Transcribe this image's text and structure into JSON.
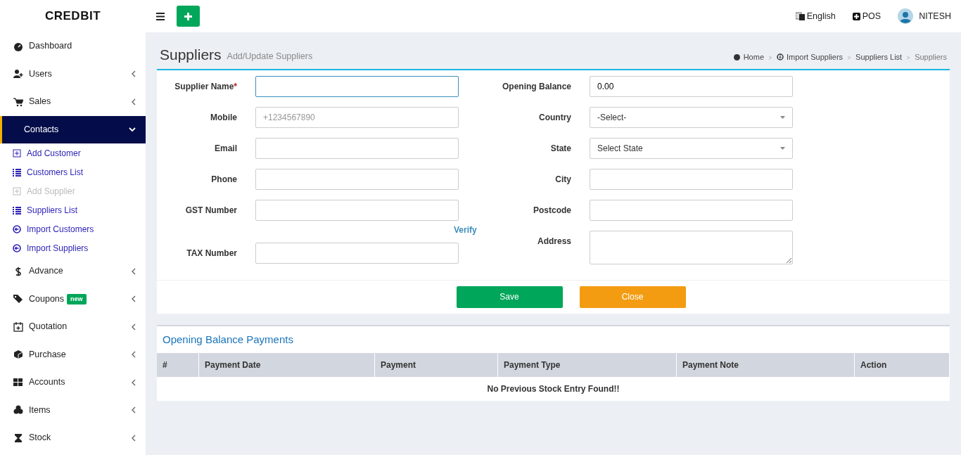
{
  "brand": "CREDBIT",
  "topbar": {
    "language": "English",
    "pos": "POS",
    "user": "NITESH"
  },
  "sidebar": {
    "items": [
      {
        "label": "Dashboard",
        "has_arrow": false,
        "expanded": false
      },
      {
        "label": "Users",
        "has_arrow": true,
        "expanded": false
      },
      {
        "label": "Sales",
        "has_arrow": true,
        "expanded": false
      },
      {
        "label": "Contacts",
        "has_arrow": true,
        "expanded": true,
        "children": [
          {
            "label": "Add Customer",
            "selected": false
          },
          {
            "label": "Customers List",
            "selected": false
          },
          {
            "label": "Add Supplier",
            "selected": true
          },
          {
            "label": "Suppliers List",
            "selected": false
          },
          {
            "label": "Import Customers",
            "selected": false
          },
          {
            "label": "Import Suppliers",
            "selected": false
          }
        ]
      },
      {
        "label": "Advance",
        "has_arrow": true,
        "expanded": false
      },
      {
        "label": "Coupons",
        "badge": "new",
        "has_arrow": true,
        "expanded": false
      },
      {
        "label": "Quotation",
        "has_arrow": true,
        "expanded": false
      },
      {
        "label": "Purchase",
        "has_arrow": true,
        "expanded": false
      },
      {
        "label": "Accounts",
        "has_arrow": true,
        "expanded": false
      },
      {
        "label": "Items",
        "has_arrow": true,
        "expanded": false
      },
      {
        "label": "Stock",
        "has_arrow": true,
        "expanded": false
      }
    ]
  },
  "page": {
    "title": "Suppliers",
    "subtitle": "Add/Update Suppliers"
  },
  "breadcrumb": [
    "Home",
    "Import Suppliers",
    "Suppliers List",
    "Suppliers"
  ],
  "form": {
    "left": [
      {
        "label": "Supplier Name",
        "required_mark": "*",
        "kind": "text",
        "focused": true
      },
      {
        "label": "Mobile",
        "kind": "text",
        "placeholder": "+1234567890"
      },
      {
        "label": "Email",
        "kind": "text"
      },
      {
        "label": "Phone",
        "kind": "text"
      },
      {
        "label": "GST Number",
        "kind": "text",
        "link": "Verify"
      },
      {
        "label": "TAX Number",
        "kind": "text"
      }
    ],
    "right": [
      {
        "label": "Opening Balance",
        "kind": "text",
        "value": "0.00"
      },
      {
        "label": "Country",
        "kind": "select",
        "value": "-Select-"
      },
      {
        "label": "State",
        "kind": "select",
        "value": "Select State"
      },
      {
        "label": "City",
        "kind": "text"
      },
      {
        "label": "Postcode",
        "kind": "text"
      },
      {
        "label": "Address",
        "kind": "textarea"
      }
    ]
  },
  "buttons": [
    {
      "label": "Save",
      "kind": "save"
    },
    {
      "label": "Close",
      "kind": "close"
    }
  ],
  "payments": {
    "title": "Opening Balance Payments",
    "columns": [
      "#",
      "Payment Date",
      "Payment",
      "Payment Type",
      "Payment Note",
      "Action"
    ],
    "empty_message": "No Previous Stock Entry Found!!"
  }
}
